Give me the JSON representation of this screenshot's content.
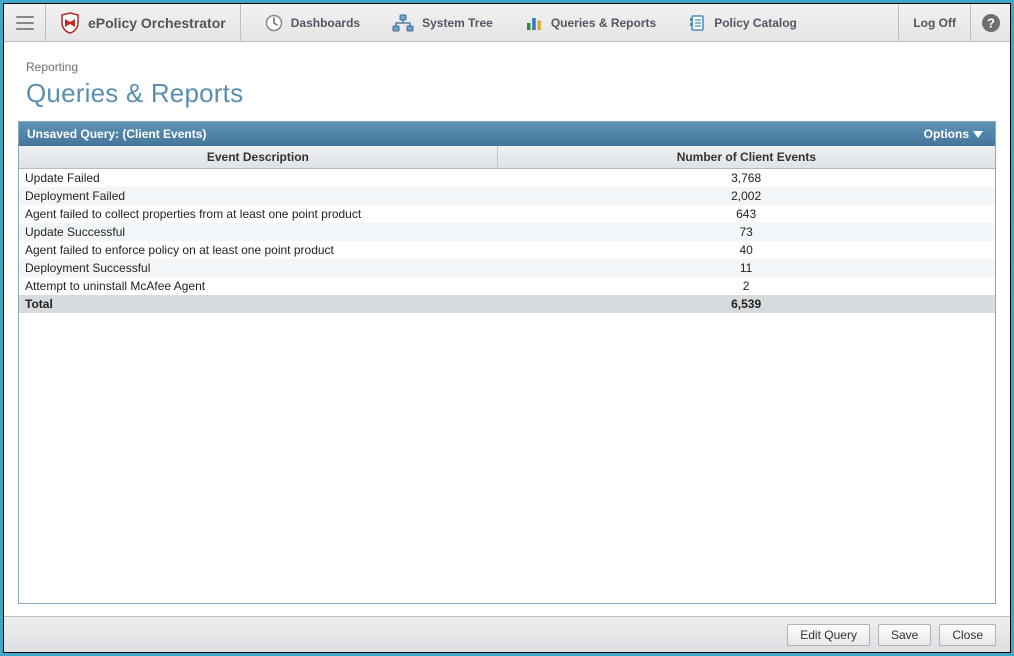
{
  "app": {
    "name": "ePolicy Orchestrator"
  },
  "topnav": {
    "items": [
      {
        "label": "Dashboards"
      },
      {
        "label": "System Tree"
      },
      {
        "label": "Queries & Reports"
      },
      {
        "label": "Policy Catalog"
      }
    ],
    "logoff": "Log Off"
  },
  "page": {
    "breadcrumb": "Reporting",
    "title": "Queries & Reports"
  },
  "panel": {
    "title": "Unsaved Query: (Client Events)",
    "options_label": "Options",
    "columns": {
      "desc": "Event Description",
      "count": "Number of Client Events"
    },
    "rows": [
      {
        "desc": "Update Failed",
        "count": "3,768"
      },
      {
        "desc": "Deployment Failed",
        "count": "2,002"
      },
      {
        "desc": "Agent failed to collect properties from at least one point product",
        "count": "643"
      },
      {
        "desc": "Update Successful",
        "count": "73"
      },
      {
        "desc": "Agent failed to enforce policy on at least one point product",
        "count": "40"
      },
      {
        "desc": "Deployment Successful",
        "count": "11"
      },
      {
        "desc": "Attempt to uninstall McAfee Agent",
        "count": "2"
      }
    ],
    "total": {
      "label": "Total",
      "count": "6,539"
    }
  },
  "footer": {
    "edit_query": "Edit Query",
    "save": "Save",
    "close": "Close"
  },
  "chart_data": {
    "type": "table",
    "title": "Unsaved Query: (Client Events)",
    "columns": [
      "Event Description",
      "Number of Client Events"
    ],
    "rows": [
      [
        "Update Failed",
        3768
      ],
      [
        "Deployment Failed",
        2002
      ],
      [
        "Agent failed to collect properties from at least one point product",
        643
      ],
      [
        "Update Successful",
        73
      ],
      [
        "Agent failed to enforce policy on at least one point product",
        40
      ],
      [
        "Deployment Successful",
        11
      ],
      [
        "Attempt to uninstall McAfee Agent",
        2
      ]
    ],
    "total": 6539
  }
}
